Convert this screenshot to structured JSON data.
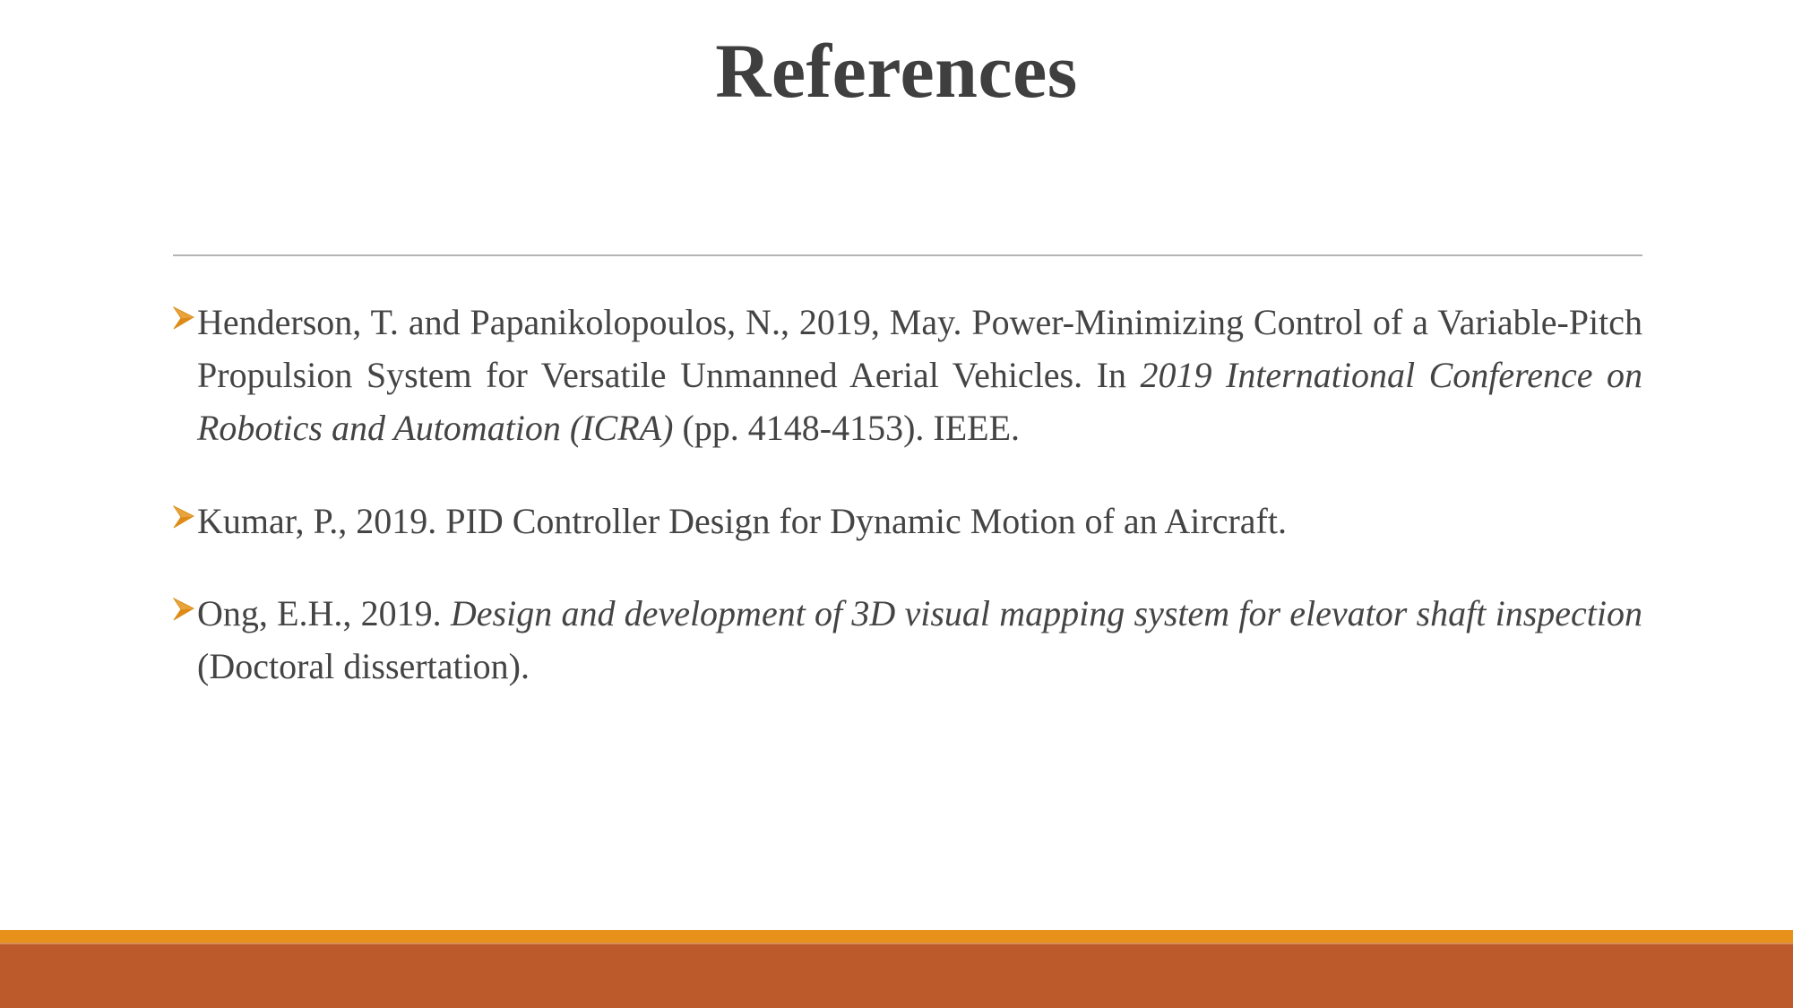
{
  "slide": {
    "title": "References",
    "accent_orange": "#e8911a",
    "accent_terracotta": "#bc5a2c",
    "text_color": "#444444",
    "title_color": "#3f3f3f",
    "divider_color": "#9b9b9b",
    "bullet_icon": "orange-arrowhead-bullet"
  },
  "references": [
    {
      "bullet": "➢",
      "parts": [
        {
          "text": "Henderson, T. and Papanikolopoulos, N., 2019, May. Power-Minimizing Control of a Variable-Pitch Propulsion System for Versatile Unmanned Aerial Vehicles. In ",
          "italic": false
        },
        {
          "text": "2019 International Conference on Robotics and Automation (ICRA)",
          "italic": true
        },
        {
          "text": " (pp. 4148-4153). IEEE.",
          "italic": false
        }
      ],
      "plain": "Henderson, T. and Papanikolopoulos, N., 2019, May. Power-Minimizing Control of a Variable-Pitch Propulsion System for Versatile Unmanned Aerial Vehicles. In 2019 International Conference on Robotics and Automation (ICRA) (pp. 4148-4153). IEEE.",
      "justified": true
    },
    {
      "bullet": "➢",
      "parts": [
        {
          "text": "Kumar, P., 2019. PID Controller Design for Dynamic Motion of an Aircraft.",
          "italic": false
        }
      ],
      "plain": "Kumar, P., 2019. PID Controller Design for Dynamic Motion of an Aircraft.",
      "justified": false
    },
    {
      "bullet": "➢",
      "parts": [
        {
          "text": "Ong, E.H., 2019. ",
          "italic": false
        },
        {
          "text": "Design and development of 3D visual mapping system for elevator shaft inspection",
          "italic": true
        },
        {
          "text": " (Doctoral dissertation).",
          "italic": false
        }
      ],
      "plain": "Ong, E.H., 2019. Design and development of 3D visual mapping system for elevator shaft inspection (Doctoral dissertation).",
      "justified": true
    }
  ]
}
